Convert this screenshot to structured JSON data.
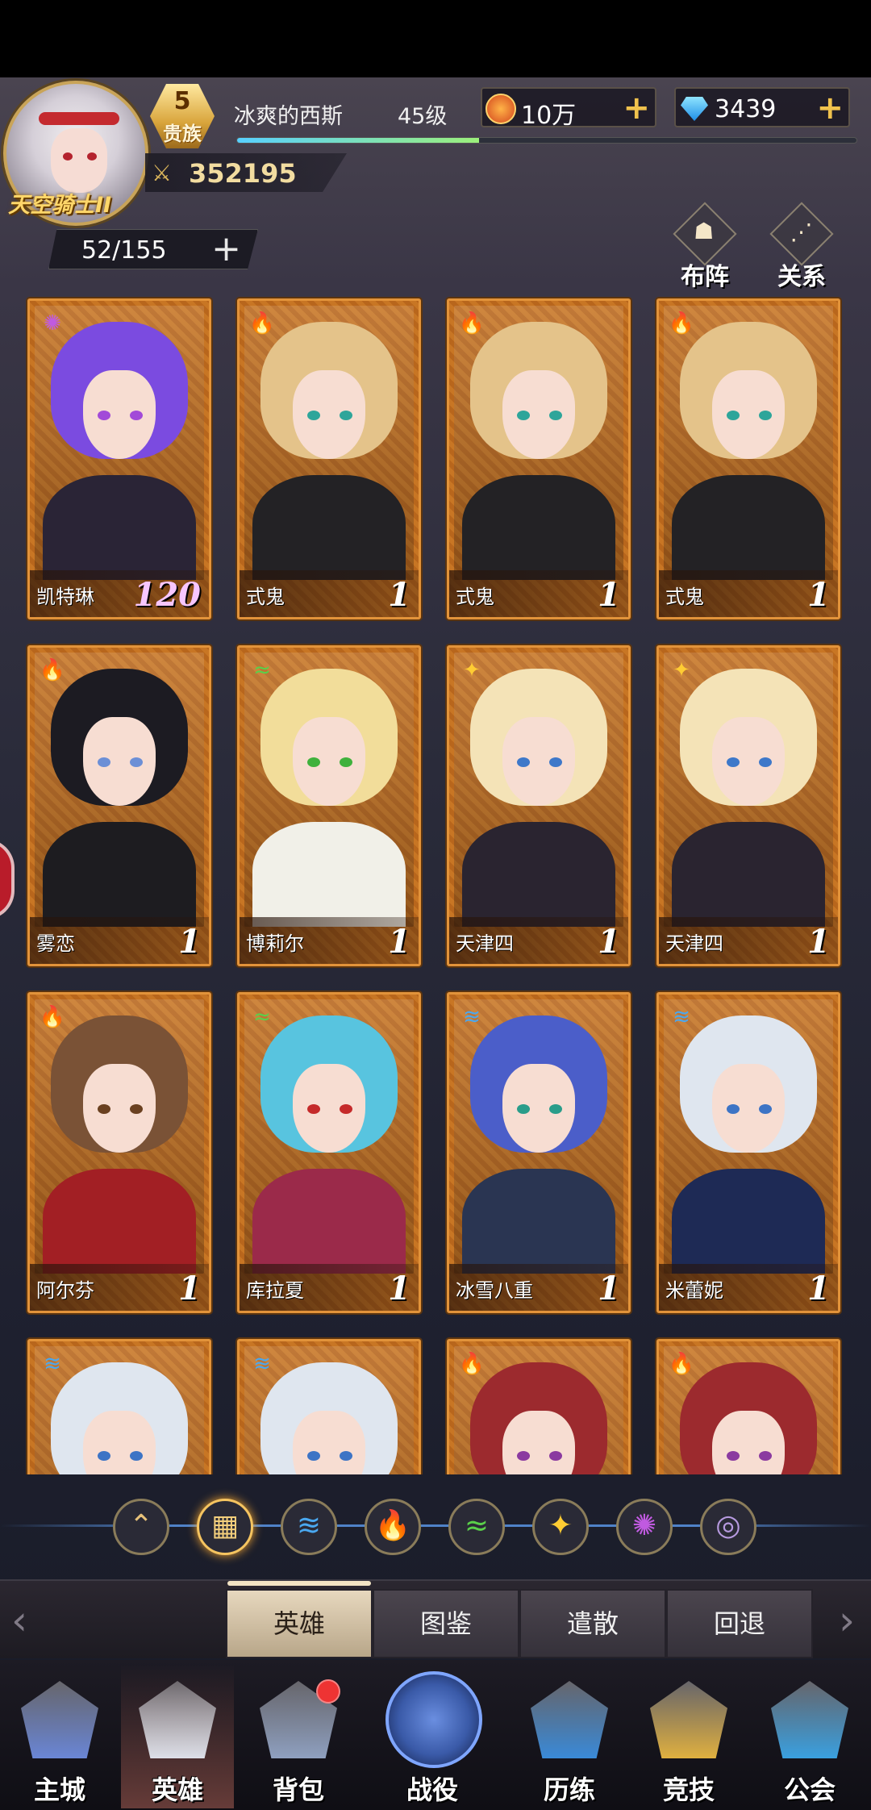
{
  "player": {
    "title": "天空骑士II",
    "vip_level": "5",
    "vip_label": "贵族",
    "name": "冰爽的西斯",
    "level": "45级",
    "xp_progress": 0.39,
    "power": "352195",
    "hero_slots": "52/155"
  },
  "resources": {
    "coins": "10万",
    "gems": "3439"
  },
  "top_buttons": {
    "formation": "布阵",
    "relations": "关系"
  },
  "heroes": [
    {
      "name": "凯特琳",
      "level": "120",
      "element": "arcane",
      "hair": "#7b4be0",
      "outfit": "#2a2436",
      "eye": "#a24ad8",
      "highlight": true
    },
    {
      "name": "式鬼",
      "level": "1",
      "element": "fire",
      "hair": "#e4c38a",
      "outfit": "#232225",
      "eye": "#2ea59a"
    },
    {
      "name": "式鬼",
      "level": "1",
      "element": "fire",
      "hair": "#e4c38a",
      "outfit": "#232225",
      "eye": "#2ea59a"
    },
    {
      "name": "式鬼",
      "level": "1",
      "element": "fire",
      "hair": "#e4c38a",
      "outfit": "#232225",
      "eye": "#2ea59a"
    },
    {
      "name": "雾恋",
      "level": "1",
      "element": "fire",
      "hair": "#1c1b22",
      "outfit": "#1d1c20",
      "eye": "#6c8fd6"
    },
    {
      "name": "博莉尔",
      "level": "1",
      "element": "wind",
      "hair": "#f2dd9a",
      "outfit": "#f1f0e8",
      "eye": "#3fb13c"
    },
    {
      "name": "天津四",
      "level": "1",
      "element": "light",
      "hair": "#f4e3b7",
      "outfit": "#2a2430",
      "eye": "#3e78c9"
    },
    {
      "name": "天津四",
      "level": "1",
      "element": "light",
      "hair": "#f4e3b7",
      "outfit": "#2a2430",
      "eye": "#3e78c9"
    },
    {
      "name": "阿尔芬",
      "level": "1",
      "element": "fire",
      "hair": "#7a5236",
      "outfit": "#a21f24",
      "eye": "#6a4020"
    },
    {
      "name": "库拉夏",
      "level": "1",
      "element": "wind",
      "hair": "#58c4df",
      "outfit": "#9b2a4a",
      "eye": "#c52a2a"
    },
    {
      "name": "冰雪八重",
      "level": "1",
      "element": "water",
      "hair": "#4b5ec9",
      "outfit": "#2a3552",
      "eye": "#2a9d8a"
    },
    {
      "name": "米蕾妮",
      "level": "1",
      "element": "water",
      "hair": "#dfe6ef",
      "outfit": "#1e2a55",
      "eye": "#3d74c5"
    },
    {
      "name": "",
      "level": "",
      "element": "water",
      "hair": "#dfe6ef",
      "outfit": "#1e2a55",
      "eye": "#3d74c5"
    },
    {
      "name": "",
      "level": "",
      "element": "water",
      "hair": "#dfe6ef",
      "outfit": "#1e2a55",
      "eye": "#3d74c5"
    },
    {
      "name": "",
      "level": "",
      "element": "fire",
      "hair": "#9c2a2e",
      "outfit": "#6a1a1e",
      "eye": "#8b3aa0"
    },
    {
      "name": "",
      "level": "",
      "element": "fire",
      "hair": "#9c2a2e",
      "outfit": "#6a1a1e",
      "eye": "#8b3aa0"
    }
  ],
  "element_filters": [
    {
      "name": "rank-up",
      "glyph": "⌃",
      "color": "#e8c27a"
    },
    {
      "name": "all",
      "glyph": "▦",
      "color": "#f3cf7c",
      "active": true
    },
    {
      "name": "water",
      "glyph": "≋",
      "color": "#4aa8f0"
    },
    {
      "name": "fire",
      "glyph": "🔥",
      "color": "#ff7a2a"
    },
    {
      "name": "wind",
      "glyph": "≈",
      "color": "#5ad04a"
    },
    {
      "name": "light",
      "glyph": "✦",
      "color": "#ffcc33"
    },
    {
      "name": "dark",
      "glyph": "✺",
      "color": "#c05ae0"
    },
    {
      "name": "chaos",
      "glyph": "◎",
      "color": "#b79ae0"
    }
  ],
  "tabs": [
    "英雄",
    "图鉴",
    "遣散",
    "回退"
  ],
  "bottom_nav": [
    {
      "label": "主城",
      "icon": "castle-icon",
      "color": "#6a86d6"
    },
    {
      "label": "英雄",
      "icon": "hero-icon",
      "color": "#dcdfe8",
      "active": true
    },
    {
      "label": "背包",
      "icon": "backpack-icon",
      "color": "#8fa0c0",
      "badge": true
    },
    {
      "label": "战役",
      "icon": "battle-icon",
      "color": "#3a5aa8"
    },
    {
      "label": "历练",
      "icon": "training-icon",
      "color": "#3a8ad8"
    },
    {
      "label": "竞技",
      "icon": "arena-icon",
      "color": "#e0b040"
    },
    {
      "label": "公会",
      "icon": "guild-icon",
      "color": "#3aa0e0"
    }
  ]
}
